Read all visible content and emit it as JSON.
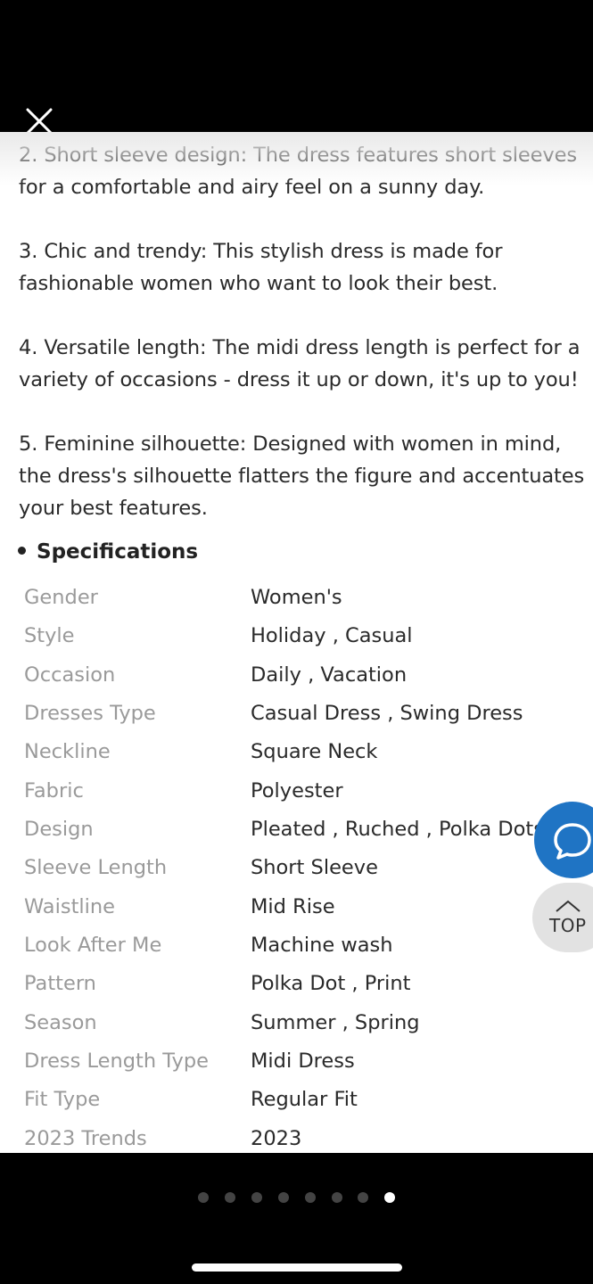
{
  "paragraphs": [
    "2. Short sleeve design: The dress features short sleeves for a comfortable and airy feel on a sunny day.",
    "3. Chic and trendy: This stylish dress is made for fashionable women who want to look their best.",
    "4. Versatile length: The midi dress length is perfect for a variety of occasions - dress it up or down, it's up to you!",
    "5. Feminine silhouette: Designed with women in mind, the dress's silhouette flatters the figure and accentuates your best features."
  ],
  "specifications": {
    "heading": "Specifications",
    "rows": [
      {
        "key": "Gender",
        "value": "Women's"
      },
      {
        "key": "Style",
        "value": "Holiday , Casual"
      },
      {
        "key": "Occasion",
        "value": "Daily , Vacation"
      },
      {
        "key": "Dresses Type",
        "value": "Casual Dress , Swing Dress"
      },
      {
        "key": "Neckline",
        "value": "Square Neck"
      },
      {
        "key": "Fabric",
        "value": "Polyester"
      },
      {
        "key": "Design",
        "value": "Pleated , Ruched , Polka Dots"
      },
      {
        "key": "Sleeve Length",
        "value": "Short Sleeve"
      },
      {
        "key": "Waistline",
        "value": "Mid Rise"
      },
      {
        "key": "Look After Me",
        "value": "Machine wash"
      },
      {
        "key": "Pattern",
        "value": "Polka Dot , Print"
      },
      {
        "key": "Season",
        "value": "Summer , Spring"
      },
      {
        "key": "Dress Length Type",
        "value": "Midi Dress"
      },
      {
        "key": "Fit Type",
        "value": "Regular Fit"
      },
      {
        "key": "2023 Trends",
        "value": "2023"
      }
    ]
  },
  "floating": {
    "chat_icon": "chat-bubble-icon",
    "top_label": "TOP"
  },
  "pagination": {
    "total": 8,
    "active": 8
  },
  "colors": {
    "chat_button": "#1f74c4",
    "top_button": "#e2e2e2",
    "label_gray": "#9a9a9a",
    "text_dark": "#2a2a2a"
  }
}
